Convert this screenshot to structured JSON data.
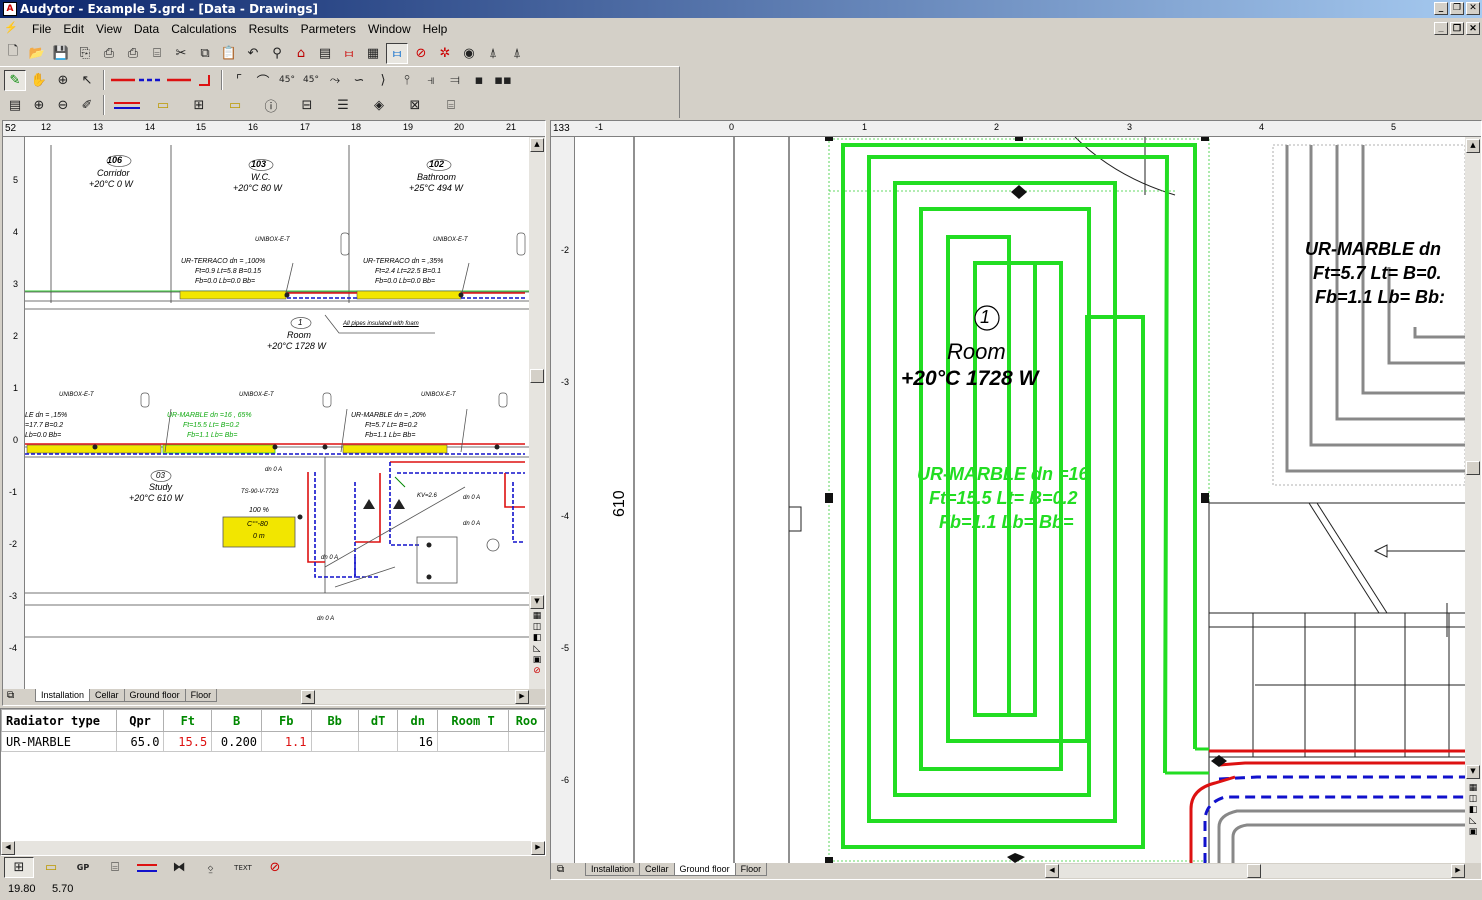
{
  "window": {
    "title": "Audytor - Example 5.grd - [Data - Drawings]",
    "app_icon": "audytor-icon",
    "buttons": {
      "minimize": "_",
      "restore": "❐",
      "close": "✕"
    }
  },
  "menu": [
    "File",
    "Edit",
    "View",
    "Data",
    "Calculations",
    "Results",
    "Parmeters",
    "Window",
    "Help"
  ],
  "left_view": {
    "ruler_corner": "52",
    "ruler_top": [
      "12",
      "13",
      "14",
      "15",
      "16",
      "17",
      "18",
      "19",
      "20",
      "21"
    ],
    "ruler_left": [
      "5",
      "4",
      "3",
      "2",
      "1",
      "0",
      "-1",
      "-2",
      "-3",
      "-4"
    ],
    "rooms": [
      {
        "num": "106",
        "name": "Corridor",
        "temp": "+20°C 0 W"
      },
      {
        "num": "103",
        "name": "W.C.",
        "temp": "+20°C 80 W"
      },
      {
        "num": "102",
        "name": "Bathroom",
        "temp": "+25°C 494 W"
      },
      {
        "num": "1",
        "name": "Room",
        "temp": "+20°C 1728 W"
      },
      {
        "num": "03",
        "name": "Study",
        "temp": "+20°C 610 W"
      }
    ],
    "labels": {
      "unibox": "UNIBOX-E-T",
      "dn": "dn",
      "ur_terraco_1": "UR-TERRACO dn = ,100%",
      "ur_terraco_1b": "Ft=0.9 Lt=5.8 B=0.15",
      "ur_terraco_1c": "Fb=0.0 Lb=0.0 Bb=",
      "ur_terraco_2": "UR-TERRACO dn = ,35%",
      "ur_terraco_2b": "Ft=2.4 Lt=22.5 B=0.1",
      "ur_terraco_2c": "Fb=0.0 Lb=0.0 Bb=",
      "insulated": "All pipes insulated with foam",
      "ur_marble_l": "LE dn = ,15%",
      "ur_marble_lb": "=17.7 B=0.2",
      "ur_marble_lc": "Lb=0.0 Bb=",
      "ur_marble_g": "UR-MARBLE dn =16 , 65%",
      "ur_marble_gb": "Ft=15.5 Lt= B=0.2",
      "ur_marble_gc": "Fb=1.1 Lb= Bb=",
      "ur_marble_r": "UR-MARBLE dn = ,20%",
      "ur_marble_rb": "Ft=5.7 Lt= B=0.2",
      "ur_marble_rc": "Fb=1.1 Lb= Bb=",
      "ts": "TS-90-V-7723",
      "hundred": "100 %",
      "kv": "KV=2.6",
      "box1": "C°°-80",
      "box2": "0 m",
      "dn0a": "dn 0 A"
    },
    "tabs": [
      "Installation",
      "Cellar",
      "Ground floor",
      "Floor"
    ],
    "active_tab": "Installation"
  },
  "table": {
    "headers": [
      "Radiator type",
      "Qpr",
      "Ft",
      "B",
      "Fb",
      "Bb",
      "dT",
      "dn",
      "Room T",
      "Roo"
    ],
    "rows": [
      [
        "UR-MARBLE",
        "65.0",
        "15.5",
        "0.200",
        "1.1",
        "",
        "",
        "16",
        "",
        ""
      ]
    ]
  },
  "bottom_tabs_icons": [
    "device-icon",
    "radiator-icon",
    "gp-icon",
    "document-icon",
    "pipes-icon",
    "network-icon",
    "report-icon",
    "text-icon",
    "stop-icon"
  ],
  "bottom_tab_gp": "GP",
  "bottom_tab_text": "TEXT",
  "right_view": {
    "ruler_corner": "133",
    "ruler_top": [
      "-1",
      "0",
      "1",
      "2",
      "3",
      "4",
      "5"
    ],
    "ruler_left": [
      "-2",
      "-3",
      "-4",
      "-5",
      "-6"
    ],
    "dimension": "610",
    "room_num": "1",
    "room_name": "Room",
    "room_temp": "+20°C 1728 W",
    "green_label_1": "UR-MARBLE dn =16",
    "green_label_2": "Ft=15.5 Lt= B=0.2",
    "green_label_3": "Fb=1.1 Lb= Bb=",
    "black_label_1": "UR-MARBLE dn",
    "black_label_2": "Ft=5.7 Lt= B=0.",
    "black_label_3": "Fb=1.1 Lb= Bb:",
    "tabs": [
      "Installation",
      "Cellar",
      "Ground floor",
      "Floor"
    ],
    "active_tab": "Ground floor"
  },
  "status": {
    "x": "19.80",
    "y": "5.70"
  },
  "colors": {
    "green": "#22dd22",
    "red": "#dd1111",
    "blue": "#1111cc",
    "yellow": "#f2e600",
    "gray": "#888888"
  }
}
